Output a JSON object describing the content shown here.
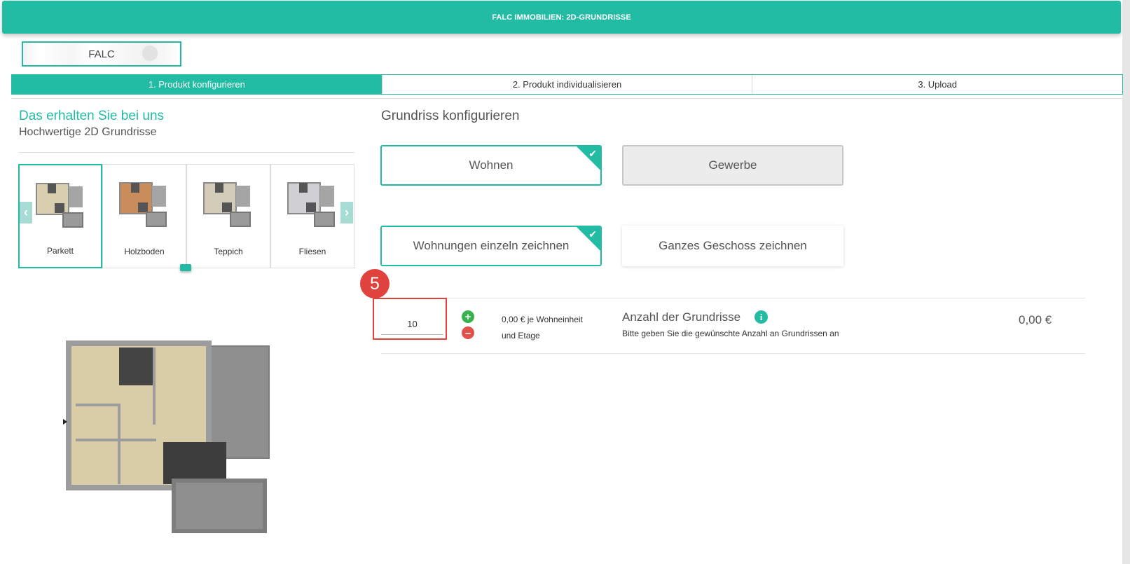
{
  "header": {
    "title": "FALC IMMOBILIEN: 2D-GRUNDRISSE"
  },
  "logo": {
    "text": "FALC"
  },
  "steps": [
    {
      "label": "1. Produkt konfigurieren",
      "active": true
    },
    {
      "label": "2. Produkt individualisieren",
      "active": false
    },
    {
      "label": "3. Upload",
      "active": false
    }
  ],
  "left": {
    "title": "Das erhalten Sie bei uns",
    "subtitle": "Hochwertige 2D Grundrisse",
    "swatches": [
      {
        "label": "Parkett",
        "selected": true
      },
      {
        "label": "Holzboden",
        "selected": false
      },
      {
        "label": "Teppich",
        "selected": false
      },
      {
        "label": "Fliesen",
        "selected": false
      }
    ]
  },
  "right": {
    "title": "Grundriss konfigurieren",
    "options_usage": [
      {
        "label": "Wohnen",
        "selected": true
      },
      {
        "label": "Gewerbe",
        "selected": false
      }
    ],
    "options_scope": [
      {
        "label": "Wohnungen einzeln zeichnen",
        "selected": true
      },
      {
        "label": "Ganzes Geschoss zeichnen",
        "selected": false
      }
    ],
    "quantity": {
      "value": "10",
      "price_note_line1": "0,00 € je Wohneinheit",
      "price_note_line2": "und Etage",
      "title": "Anzahl der Grundrisse",
      "subtitle": "Bitte geben Sie die gewünschte Anzahl an Grundrissen an",
      "total": "0,00 €"
    }
  },
  "annotation": {
    "badge": "5"
  },
  "colors": {
    "accent": "#22bba3",
    "highlight": "#e0423d",
    "plus": "#38b24c",
    "minus": "#e2504a"
  },
  "icons": {
    "check": "check-icon",
    "prev": "chevron-left-icon",
    "next": "chevron-right-icon",
    "plus": "plus-icon",
    "minus": "minus-icon",
    "info": "info-icon"
  }
}
